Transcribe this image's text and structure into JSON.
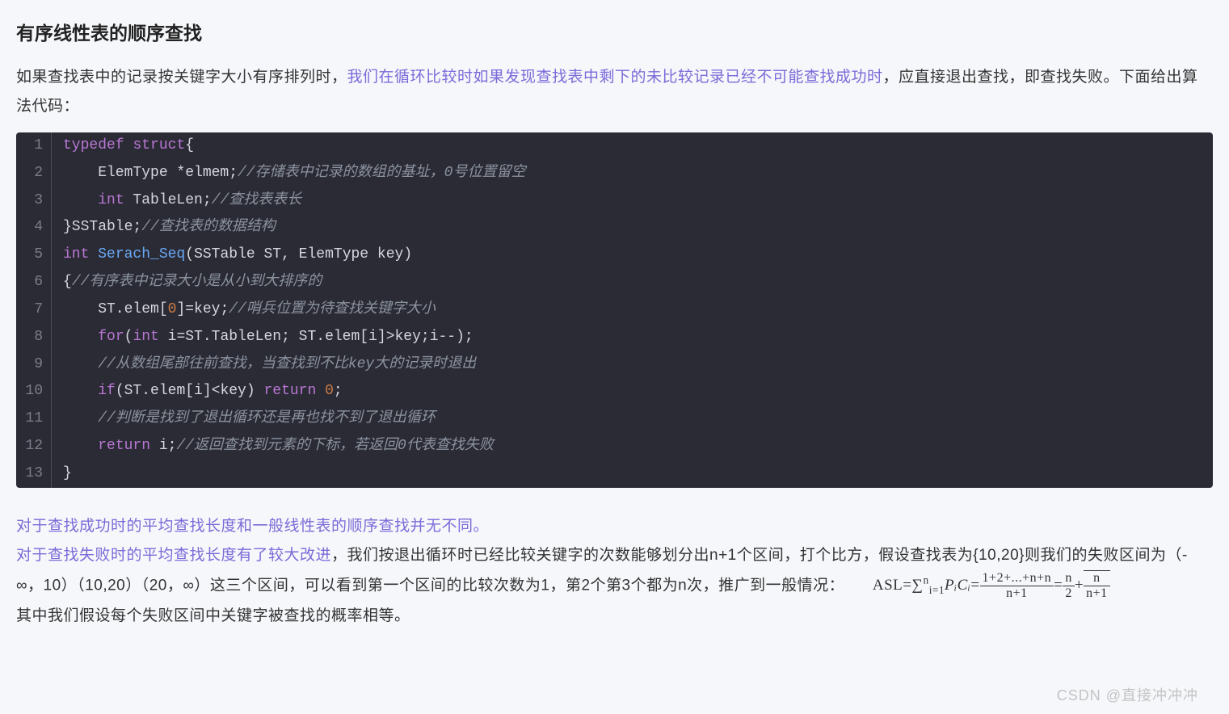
{
  "heading": "有序线性表的顺序查找",
  "intro": {
    "p1a": "如果查找表中的记录按关键字大小有序排列时，",
    "p1b": "我们在循环比较时如果发现查找表中剩下的未比较记录已经不可能查找成功时",
    "p1c": "，应直接退出查找，即查找失败。下面给出算法代码：",
    "after1": "对于查找成功时的平均查找长度和一般线性表的顺序查找并无不同。",
    "after2a": "对于查找失败时的平均查找长度有了较大改进",
    "after2b": "，我们按退出循环时已经比较关键字的次数能够划分出n+1个区间，打个比方，假设查找表为{10,20}则我们的失败区间为（- ∞，10）（10,20）（20，∞）这三个区间，可以看到第一个区间的比较次数为1，第2个第3个都为n次，推广到一般情况：",
    "asl_prefix": "ASL=",
    "asl_sum_prefix": "∑",
    "asl_sum_upper": "n",
    "asl_sum_lower": "i=1",
    "asl_PC": "PᵢCᵢ",
    "asl_eq": "=",
    "frac1_num": "1+2+...+n+n",
    "frac1_den": "n+1",
    "frac2_num": "n",
    "frac2_den": "2",
    "asl_plus": "+",
    "frac3_num": "n",
    "frac3_den": "n+1",
    "after3": "其中我们假设每个失败区间中关键字被查找的概率相等。"
  },
  "code": {
    "lines": [
      {
        "n": "1",
        "segs": [
          [
            "kw",
            "typedef"
          ],
          [
            "plain",
            " "
          ],
          [
            "kw",
            "struct"
          ],
          [
            "plain",
            "{"
          ]
        ]
      },
      {
        "n": "2",
        "segs": [
          [
            "plain",
            "    ElemType *elmem;"
          ],
          [
            "cmt",
            "//存储表中记录的数组的基址，0号位置留空"
          ]
        ]
      },
      {
        "n": "3",
        "segs": [
          [
            "plain",
            "    "
          ],
          [
            "kw",
            "int"
          ],
          [
            "plain",
            " TableLen;"
          ],
          [
            "cmt",
            "//查找表表长"
          ]
        ]
      },
      {
        "n": "4",
        "segs": [
          [
            "plain",
            "}SSTable;"
          ],
          [
            "cmt",
            "//查找表的数据结构"
          ]
        ]
      },
      {
        "n": "5",
        "segs": [
          [
            "kw",
            "int"
          ],
          [
            "plain",
            " "
          ],
          [
            "fn",
            "Serach_Seq"
          ],
          [
            "plain",
            "("
          ],
          [
            "prm",
            "SSTable ST, ElemType key"
          ],
          [
            "plain",
            ")"
          ]
        ]
      },
      {
        "n": "6",
        "segs": [
          [
            "plain",
            "{"
          ],
          [
            "cmt",
            "//有序表中记录大小是从小到大排序的"
          ]
        ]
      },
      {
        "n": "7",
        "segs": [
          [
            "plain",
            "    ST.elem["
          ],
          [
            "num",
            "0"
          ],
          [
            "plain",
            "]=key;"
          ],
          [
            "cmt",
            "//哨兵位置为待查找关键字大小"
          ]
        ]
      },
      {
        "n": "8",
        "segs": [
          [
            "plain",
            "    "
          ],
          [
            "kw",
            "for"
          ],
          [
            "plain",
            "("
          ],
          [
            "kw",
            "int"
          ],
          [
            "plain",
            " i=ST.TableLen; ST.elem[i]>key;i--);"
          ]
        ]
      },
      {
        "n": "9",
        "segs": [
          [
            "plain",
            "    "
          ],
          [
            "cmt",
            "//从数组尾部往前查找，当查找到不比key大的记录时退出"
          ]
        ]
      },
      {
        "n": "10",
        "segs": [
          [
            "plain",
            "    "
          ],
          [
            "kw",
            "if"
          ],
          [
            "plain",
            "(ST.elem[i]<key) "
          ],
          [
            "kw",
            "return"
          ],
          [
            "plain",
            " "
          ],
          [
            "num",
            "0"
          ],
          [
            "plain",
            ";"
          ]
        ]
      },
      {
        "n": "11",
        "segs": [
          [
            "plain",
            "    "
          ],
          [
            "cmt",
            "//判断是找到了退出循环还是再也找不到了退出循环"
          ]
        ]
      },
      {
        "n": "12",
        "segs": [
          [
            "plain",
            "    "
          ],
          [
            "kw",
            "return"
          ],
          [
            "plain",
            " i;"
          ],
          [
            "cmt",
            "//返回查找到元素的下标，若返回0代表查找失败"
          ]
        ]
      },
      {
        "n": "13",
        "segs": [
          [
            "plain",
            "}"
          ]
        ]
      }
    ]
  },
  "watermark": "CSDN @直接冲冲冲"
}
